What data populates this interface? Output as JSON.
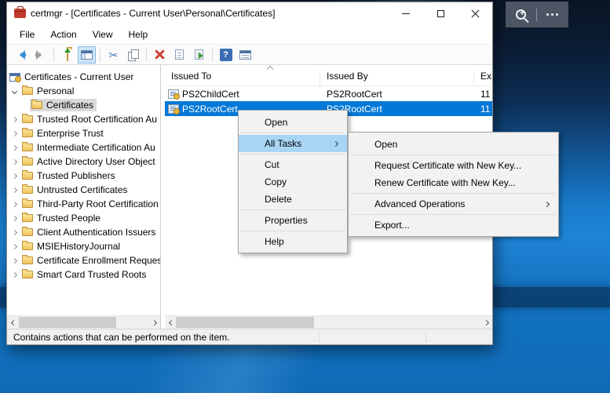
{
  "desktop_toolbar": {
    "buttons": [
      {
        "icon": "zoom-magnifier-plus-icon"
      },
      {
        "icon": "more-options-ellipsis-icon"
      }
    ]
  },
  "window": {
    "icon": "mmc-toolbox-icon",
    "title": "certmgr - [Certificates - Current User\\Personal\\Certificates]",
    "controls": [
      {
        "icon": "minimize-icon"
      },
      {
        "icon": "maximize-icon"
      },
      {
        "icon": "close-icon"
      }
    ]
  },
  "menu_bar": {
    "items": [
      {
        "label": "File"
      },
      {
        "label": "Action"
      },
      {
        "label": "View"
      },
      {
        "label": "Help"
      }
    ]
  },
  "toolbar": {
    "cut_glyph": "✂",
    "help_glyph": "?",
    "buttons": [
      {
        "icon": "back-icon"
      },
      {
        "icon": "forward-icon"
      },
      {
        "icon": "up-one-level-icon"
      },
      {
        "icon": "show-console-tree-icon",
        "active": true
      },
      {
        "icon": "cut-icon"
      },
      {
        "icon": "copy-icon"
      },
      {
        "icon": "delete-icon"
      },
      {
        "icon": "properties-icon"
      },
      {
        "icon": "export-list-icon"
      },
      {
        "icon": "help-icon"
      },
      {
        "icon": "list-view-icon"
      }
    ]
  },
  "tree": {
    "items": [
      {
        "label": "Certificates - Current User",
        "icon": "console-root-icon",
        "indent": 0,
        "state": "none"
      },
      {
        "label": "Personal",
        "icon": "folder-icon",
        "indent": 1,
        "state": "expanded"
      },
      {
        "label": "Certificates",
        "icon": "folder-icon",
        "indent": 2,
        "state": "none",
        "selected": true
      },
      {
        "label": "Trusted Root Certification Au",
        "icon": "folder-icon",
        "indent": 1,
        "state": "collapsed"
      },
      {
        "label": "Enterprise Trust",
        "icon": "folder-icon",
        "indent": 1,
        "state": "collapsed"
      },
      {
        "label": "Intermediate Certification Au",
        "icon": "folder-icon",
        "indent": 1,
        "state": "collapsed"
      },
      {
        "label": "Active Directory User Object",
        "icon": "folder-icon",
        "indent": 1,
        "state": "collapsed"
      },
      {
        "label": "Trusted Publishers",
        "icon": "folder-icon",
        "indent": 1,
        "state": "collapsed"
      },
      {
        "label": "Untrusted Certificates",
        "icon": "folder-icon",
        "indent": 1,
        "state": "collapsed"
      },
      {
        "label": "Third-Party Root Certification",
        "icon": "folder-icon",
        "indent": 1,
        "state": "collapsed"
      },
      {
        "label": "Trusted People",
        "icon": "folder-icon",
        "indent": 1,
        "state": "collapsed"
      },
      {
        "label": "Client Authentication Issuers",
        "icon": "folder-icon",
        "indent": 1,
        "state": "collapsed"
      },
      {
        "label": "MSIEHistoryJournal",
        "icon": "folder-icon",
        "indent": 1,
        "state": "collapsed"
      },
      {
        "label": "Certificate Enrollment Reques",
        "icon": "folder-icon",
        "indent": 1,
        "state": "collapsed"
      },
      {
        "label": "Smart Card Trusted Roots",
        "icon": "folder-icon",
        "indent": 1,
        "state": "collapsed"
      }
    ]
  },
  "list": {
    "columns": [
      {
        "label": "Issued To",
        "sorted": "ascending"
      },
      {
        "label": "Issued By"
      },
      {
        "label": "Ex"
      }
    ],
    "rows": [
      {
        "issued_to": "PS2ChildCert",
        "issued_by": "PS2RootCert",
        "expiration": "11"
      },
      {
        "issued_to": "PS2RootCert",
        "issued_by": "PS2RootCert",
        "expiration": "11",
        "selected": true
      }
    ]
  },
  "context_menu": {
    "items": [
      {
        "label": "Open"
      },
      {
        "label": "All Tasks",
        "has_submenu": true,
        "highlighted": true
      },
      {
        "label": "Cut"
      },
      {
        "label": "Copy"
      },
      {
        "label": "Delete"
      },
      {
        "label": "Properties"
      },
      {
        "label": "Help"
      }
    ]
  },
  "all_tasks_submenu": {
    "items": [
      {
        "label": "Open"
      },
      {
        "label": "Request Certificate with New Key..."
      },
      {
        "label": "Renew Certificate with New Key..."
      },
      {
        "label": "Advanced Operations",
        "has_submenu": true
      },
      {
        "label": "Export..."
      }
    ]
  },
  "status_bar": {
    "text": "Contains actions that can be performed on the item."
  },
  "colors": {
    "selection_blue": "#0078d7",
    "menu_highlight": "#a9d5f5",
    "tree_selection_gray": "#d9d9d9",
    "desktop_blue": "#1b7ed2"
  }
}
